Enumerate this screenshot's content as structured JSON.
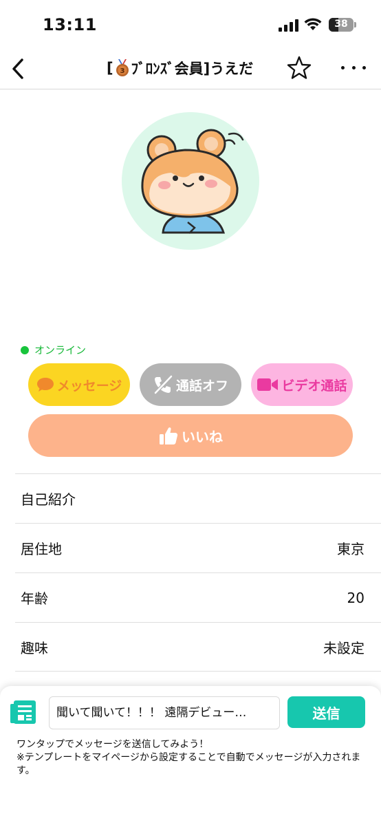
{
  "status_bar": {
    "time": "13:11",
    "battery": "38",
    "battery_level": 0.38
  },
  "nav": {
    "title_prefix": "[",
    "title_rank": "ﾌﾞﾛﾝｽﾞ会員]うえだ"
  },
  "profile": {
    "online_label": "オンライン",
    "buttons": {
      "message": "メッセージ",
      "call": "通話オフ",
      "video": "ビデオ通話",
      "like": "いいね"
    },
    "rows": [
      {
        "label": "自己紹介",
        "value": ""
      },
      {
        "label": "居住地",
        "value": "東京"
      },
      {
        "label": "年齢",
        "value": "20"
      },
      {
        "label": "趣味",
        "value": "未設定"
      }
    ]
  },
  "composer": {
    "input_value": "聞いて聞いて！！！ 遠隔デビュー…",
    "send_label": "送信",
    "hint_line1": "ワンタップでメッセージを送信してみよう！",
    "hint_line2": "※テンプレートをマイページから設定することで自動でメッセージが入力されます。"
  },
  "colors": {
    "online": "#19b93a",
    "message_bg": "#fbd522",
    "call_bg": "#b3b3b3",
    "video_bg": "#fdb5e1",
    "like_bg": "#fdb38b",
    "send_bg": "#17c7ae",
    "avatar_bg": "#dcf8ea"
  },
  "icons": [
    "back-chevron-icon",
    "bronze-medal-icon",
    "star-outline-icon",
    "more-icon",
    "speech-bubble-icon",
    "phone-off-icon",
    "video-camera-icon",
    "thumbs-up-icon",
    "template-icon"
  ]
}
